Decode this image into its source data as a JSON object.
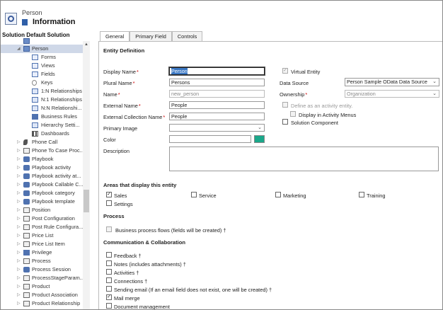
{
  "header": {
    "entity": "Person",
    "title": "Information"
  },
  "sidebar": {
    "solution_title": "Solution Default Solution",
    "items": [
      {
        "label": "",
        "level": 0,
        "arrow": "",
        "icon": "entity"
      },
      {
        "label": "Person",
        "level": 0,
        "arrow": "◢",
        "icon": "entity",
        "selected": true
      },
      {
        "label": "Forms",
        "level": 1,
        "arrow": "",
        "icon": "form"
      },
      {
        "label": "Views",
        "level": 1,
        "arrow": "",
        "icon": "form"
      },
      {
        "label": "Fields",
        "level": 1,
        "arrow": "",
        "icon": "form"
      },
      {
        "label": "Keys",
        "level": 1,
        "arrow": "",
        "icon": "key"
      },
      {
        "label": "1:N Relationships",
        "level": 1,
        "arrow": "",
        "icon": "rel"
      },
      {
        "label": "N:1 Relationships",
        "level": 1,
        "arrow": "",
        "icon": "rel"
      },
      {
        "label": "N:N Relationshi...",
        "level": 1,
        "arrow": "",
        "icon": "rel"
      },
      {
        "label": "Business Rules",
        "level": 1,
        "arrow": "",
        "icon": "rule"
      },
      {
        "label": "Hierarchy Setti...",
        "level": 1,
        "arrow": "",
        "icon": "rel"
      },
      {
        "label": "Dashboards",
        "level": 1,
        "arrow": "",
        "icon": "dash"
      },
      {
        "label": "Phone Call",
        "level": 0,
        "arrow": "▷",
        "icon": "phone"
      },
      {
        "label": "Phone To Case Proc...",
        "level": 0,
        "arrow": "▷",
        "icon": "pos"
      },
      {
        "label": "Playbook",
        "level": 0,
        "arrow": "▷",
        "icon": "play"
      },
      {
        "label": "Playbook activity",
        "level": 0,
        "arrow": "▷",
        "icon": "play"
      },
      {
        "label": "Playbook activity at...",
        "level": 0,
        "arrow": "▷",
        "icon": "play"
      },
      {
        "label": "Playbook Callable C...",
        "level": 0,
        "arrow": "▷",
        "icon": "play"
      },
      {
        "label": "Playbook category",
        "level": 0,
        "arrow": "▷",
        "icon": "play"
      },
      {
        "label": "Playbook template",
        "level": 0,
        "arrow": "▷",
        "icon": "play"
      },
      {
        "label": "Position",
        "level": 0,
        "arrow": "▷",
        "icon": "pos"
      },
      {
        "label": "Post Configuration",
        "level": 0,
        "arrow": "▷",
        "icon": "pos"
      },
      {
        "label": "Post Rule Configura...",
        "level": 0,
        "arrow": "▷",
        "icon": "pos"
      },
      {
        "label": "Price List",
        "level": 0,
        "arrow": "▷",
        "icon": "pos"
      },
      {
        "label": "Price List Item",
        "level": 0,
        "arrow": "▷",
        "icon": "pos"
      },
      {
        "label": "Privilege",
        "level": 0,
        "arrow": "▷",
        "icon": "rule"
      },
      {
        "label": "Process",
        "level": 0,
        "arrow": "▷",
        "icon": "pos"
      },
      {
        "label": "Process Session",
        "level": 0,
        "arrow": "▷",
        "icon": "play"
      },
      {
        "label": "ProcessStageParam...",
        "level": 0,
        "arrow": "▷",
        "icon": "pos"
      },
      {
        "label": "Product",
        "level": 0,
        "arrow": "▷",
        "icon": "pos"
      },
      {
        "label": "Product Association",
        "level": 0,
        "arrow": "▷",
        "icon": "pos"
      },
      {
        "label": "Product Relationship",
        "level": 0,
        "arrow": "▷",
        "icon": "pos"
      }
    ]
  },
  "tabs": [
    {
      "label": "General",
      "active": true
    },
    {
      "label": "Primary Field",
      "active": false
    },
    {
      "label": "Controls",
      "active": false
    }
  ],
  "entity_definition": {
    "title": "Entity Definition",
    "display_name_label": "Display Name",
    "display_name_value": "Person",
    "plural_name_label": "Plural Name",
    "plural_name_value": "Persons",
    "name_label": "Name",
    "name_value": "new_person",
    "external_name_label": "External Name",
    "external_name_value": "People",
    "external_collection_label": "External Collection Name",
    "external_collection_value": "People",
    "primary_image_label": "Primary Image",
    "color_label": "Color",
    "color_value": "#1aa88a",
    "description_label": "Description",
    "virtual_entity_label": "Virtual Entity",
    "data_source_label": "Data Source",
    "data_source_value": "Person Sample OData Data Source",
    "ownership_label": "Ownership",
    "ownership_value": "Organization",
    "define_activity_label": "Define as an activity entity.",
    "display_activity_menus_label": "Display in Activity Menus",
    "solution_component_label": "Solution Component"
  },
  "areas": {
    "title": "Areas that display this entity",
    "items": [
      {
        "label": "Sales",
        "checked": true
      },
      {
        "label": "Service",
        "checked": false
      },
      {
        "label": "Marketing",
        "checked": false
      },
      {
        "label": "Training",
        "checked": false
      },
      {
        "label": "Settings",
        "checked": false
      }
    ]
  },
  "process": {
    "title": "Process",
    "business_process_label": "Business process flows (fields will be created) †"
  },
  "communication": {
    "title": "Communication & Collaboration",
    "items": [
      {
        "label": "Feedback †",
        "checked": false
      },
      {
        "label": "Notes (includes attachments) †",
        "checked": false
      },
      {
        "label": "Activities †",
        "checked": false
      },
      {
        "label": "Connections †",
        "checked": false
      },
      {
        "label": "Sending email (If an email field does not exist, one will be created) †",
        "checked": false
      },
      {
        "label": "Mail merge",
        "checked": true
      },
      {
        "label": "Document management",
        "checked": false
      }
    ]
  },
  "glyphs": {
    "check": "✓",
    "chevron": "⌄",
    "scroll_up": "▲"
  }
}
